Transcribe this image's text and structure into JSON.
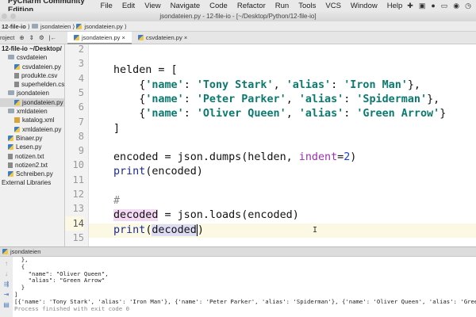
{
  "menubar": {
    "app": "PyCharm Community Edition",
    "items": [
      "File",
      "Edit",
      "View",
      "Navigate",
      "Code",
      "Refactor",
      "Run",
      "Tools",
      "VCS",
      "Window",
      "Help"
    ],
    "icons": [
      "plugin-icon",
      "bag-icon",
      "shield-icon",
      "screen-icon",
      "chat-icon",
      "clock-icon"
    ]
  },
  "window": {
    "title": "jsondateien.py - 12-file-io - [~/Desktop/Python/12-file-io]"
  },
  "breadcrumb": [
    "12-file-io",
    "jsondateien",
    "jsondateien.py"
  ],
  "toolbar": {
    "project_label": "roject"
  },
  "tabs": [
    {
      "label": "jsondateien.py",
      "active": true
    },
    {
      "label": "csvdateien.py",
      "active": false
    }
  ],
  "tree": [
    {
      "label": "12-file-io  ~/Desktop/",
      "type": "root",
      "indent": 0
    },
    {
      "label": "csvdateien",
      "type": "folder",
      "indent": 1
    },
    {
      "label": "csvdateien.py",
      "type": "py",
      "indent": 2
    },
    {
      "label": "produkte.csv",
      "type": "file",
      "indent": 2
    },
    {
      "label": "superhelden.csv",
      "type": "file",
      "indent": 2
    },
    {
      "label": "jsondateien",
      "type": "folder",
      "indent": 1
    },
    {
      "label": "jsondateien.py",
      "type": "py",
      "indent": 2,
      "selected": true
    },
    {
      "label": "xmldateien",
      "type": "folder",
      "indent": 1
    },
    {
      "label": "katalog.xml",
      "type": "xml",
      "indent": 2
    },
    {
      "label": "xmldateien.py",
      "type": "py",
      "indent": 2
    },
    {
      "label": "Binaer.py",
      "type": "py",
      "indent": 1
    },
    {
      "label": "Lesen.py",
      "type": "py",
      "indent": 1
    },
    {
      "label": "notizen.txt",
      "type": "file",
      "indent": 1
    },
    {
      "label": "notizen2.txt",
      "type": "file",
      "indent": 1
    },
    {
      "label": "Schreiben.py",
      "type": "py",
      "indent": 1
    },
    {
      "label": "External Libraries",
      "type": "lib",
      "indent": 0
    }
  ],
  "editor": {
    "line_numbers": [
      "2",
      "3",
      "4",
      "5",
      "6",
      "7",
      "8",
      "9",
      "10",
      "11",
      "12",
      "13",
      "14",
      "15"
    ],
    "current_line": "14",
    "code": {
      "l3": "helden = [",
      "l4a": "    {",
      "l4b": "'name'",
      "l4c": ": ",
      "l4d": "'Tony Stark'",
      "l4e": ", ",
      "l4f": "'alias'",
      "l4g": ": ",
      "l4h": "'Iron Man'",
      "l4i": "},",
      "l5a": "    {",
      "l5b": "'name'",
      "l5c": ": ",
      "l5d": "'Peter Parker'",
      "l5e": ", ",
      "l5f": "'alias'",
      "l5g": ": ",
      "l5h": "'Spiderman'",
      "l5i": "},",
      "l6a": "    {",
      "l6b": "'name'",
      "l6c": ": ",
      "l6d": "'Oliver Queen'",
      "l6e": ", ",
      "l6f": "'alias'",
      "l6g": ": ",
      "l6h": "'Green Arrow'",
      "l6i": "}",
      "l7": "]",
      "l9a": "encoded = json.dumps(helden, ",
      "l9b": "indent",
      "l9c": "=",
      "l9d": "2",
      "l9e": ")",
      "l10a": "print",
      "l10b": "(encoded)",
      "l12": "#",
      "l13a": "decoded",
      "l13b": " = json.loads(encoded)",
      "l14a": "print",
      "l14b": "(",
      "l14c": "decoded",
      "l14d": ")"
    }
  },
  "run": {
    "tab_label": "jsondateien",
    "output": [
      "  },",
      "  {",
      "    \"name\": \"Oliver Queen\",",
      "    \"alias\": \"Green Arrow\"",
      "  }",
      "]",
      "[{'name': 'Tony Stark', 'alias': 'Iron Man'}, {'name': 'Peter Parker', 'alias': 'Spiderman'}, {'name': 'Oliver Queen', 'alias': 'Green Arrow'}]",
      "Process finished with exit code 0"
    ]
  }
}
